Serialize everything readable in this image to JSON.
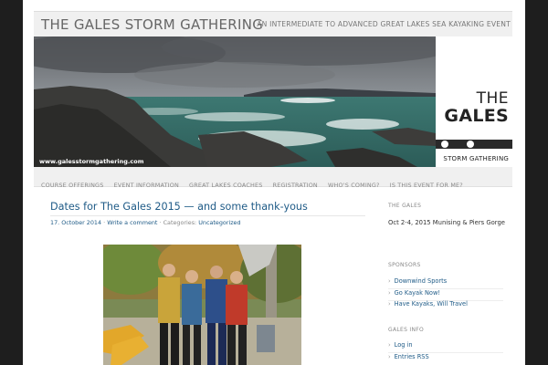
{
  "site": {
    "title": "THE GALES STORM GATHERING",
    "description": "AN INTERMEDIATE TO ADVANCED GREAT LAKES SEA KAYAKING EVENT"
  },
  "banner": {
    "url_text": "www.galesstormgathering.com",
    "logo_the": "THE",
    "logo_gales": "GALES",
    "logo_storm": "STORM GATHERING"
  },
  "nav": {
    "items": [
      {
        "label": "COURSE OFFERINGS"
      },
      {
        "label": "EVENT INFORMATION"
      },
      {
        "label": "GREAT LAKES COACHES"
      },
      {
        "label": "REGISTRATION"
      },
      {
        "label": "WHO'S COMING?"
      },
      {
        "label": "IS THIS EVENT FOR ME?"
      }
    ]
  },
  "post": {
    "title": "Dates for The Gales 2015 — and some thank-yous",
    "date": "17. October 2014",
    "comment_link": "Write a comment",
    "categories_label": "Categories:",
    "category": "Uncategorized",
    "separator": "·"
  },
  "sidebar": {
    "gales": {
      "title": "THE GALES",
      "text": "Oct 2-4, 2015 Munising & Piers Gorge"
    },
    "sponsors": {
      "title": "SPONSORS",
      "items": [
        "Downwind Sports",
        "Go Kayak Now!",
        "Have Kayaks, Will Travel"
      ]
    },
    "info": {
      "title": "GALES INFO",
      "items": [
        "Log in",
        "Entries RSS"
      ]
    }
  },
  "colors": {
    "link": "#1f5b87",
    "page_bg": "#1e1e1e",
    "header_bg": "#f0f0f0"
  }
}
